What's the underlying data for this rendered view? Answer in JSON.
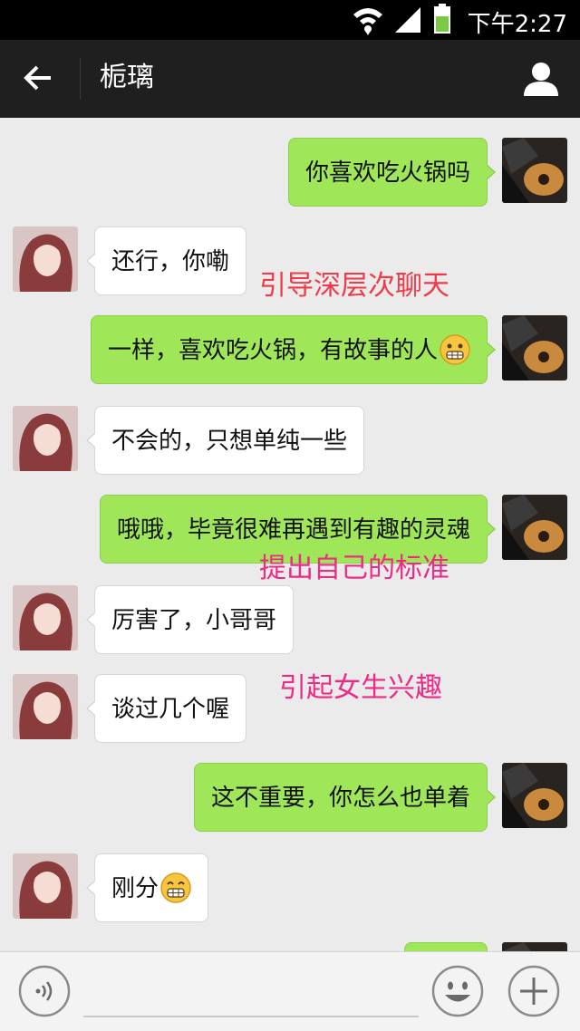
{
  "status_bar": {
    "time": "下午2:27",
    "wifi_icon": "wifi-icon",
    "signal_icon": "signal-icon",
    "battery_icon": "battery-icon"
  },
  "header": {
    "title": "栀璃",
    "back_icon": "back-arrow-icon",
    "profile_icon": "person-icon"
  },
  "messages": [
    {
      "side": "out",
      "text": "你喜欢吃火锅吗"
    },
    {
      "side": "in",
      "text": "还行，你嘞"
    },
    {
      "side": "out",
      "text": "一样，喜欢吃火锅，有故事的人",
      "emoji": "grin-emoji"
    },
    {
      "side": "in",
      "text": "不会的，只想单纯一些"
    },
    {
      "side": "out",
      "text": "哦哦，毕竟很难再遇到有趣的灵魂"
    },
    {
      "side": "in",
      "text": "厉害了，小哥哥"
    },
    {
      "side": "in",
      "text": "谈过几个喔"
    },
    {
      "side": "out",
      "text": "这不重要，你怎么也单着"
    },
    {
      "side": "in",
      "text": "刚分",
      "emoji": "grin-emoji"
    },
    {
      "side": "out",
      "text": ""
    }
  ],
  "annotations": [
    {
      "text": "引导深层次聊天",
      "color": "#f0394a"
    },
    {
      "text": "提出自己的标准",
      "color": "#ee2a86"
    },
    {
      "text": "引起女生兴趣",
      "color": "#ee2a86"
    }
  ],
  "input_bar": {
    "voice_icon": "voice-icon",
    "emoji_icon": "smiley-icon",
    "plus_icon": "plus-icon",
    "value": ""
  },
  "colors": {
    "outgoing_bubble": "#9fe658",
    "incoming_bubble": "#ffffff",
    "header_bg": "#1f1f1f",
    "chat_bg": "#ebebeb"
  }
}
